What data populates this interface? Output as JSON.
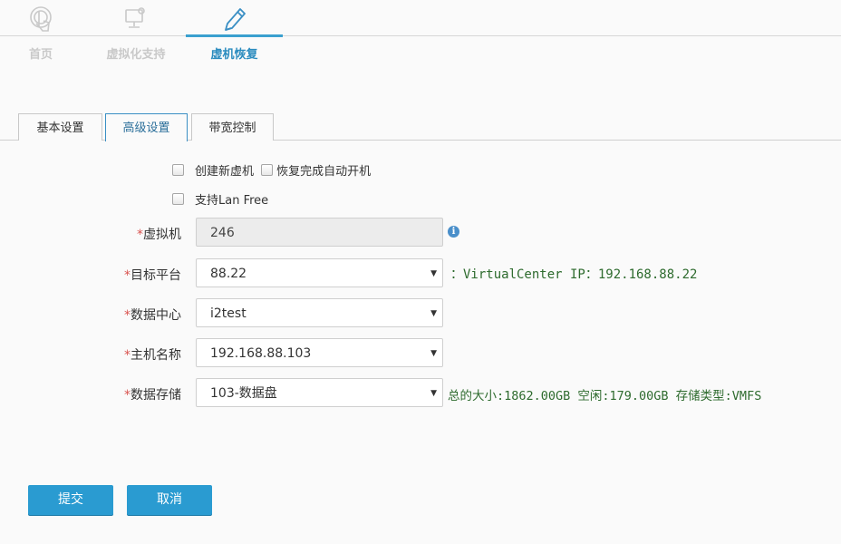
{
  "nav": {
    "items": [
      {
        "label": "首页",
        "icon": "touch-icon"
      },
      {
        "label": "虚拟化支持",
        "icon": "monitor-settings-icon"
      },
      {
        "label": "虚机恢复",
        "icon": "pencil-icon"
      }
    ],
    "active_index": 2
  },
  "tabs": [
    {
      "label": "基本设置"
    },
    {
      "label": "高级设置"
    },
    {
      "label": "带宽控制"
    }
  ],
  "active_tab": 1,
  "options": {
    "create_vm": "创建新虚机",
    "auto_start": "恢复完成自动开机",
    "lan_free": "支持Lan Free"
  },
  "form": {
    "required_mark": "*",
    "vm": {
      "label": "虚拟机",
      "value": "246"
    },
    "platform": {
      "label": "目标平台",
      "value": "88.22",
      "note": "：VirtualCenter IP：192.168.88.22"
    },
    "datacenter": {
      "label": "数据中心",
      "value": "i2test"
    },
    "host": {
      "label": "主机名称",
      "value": "192.168.88.103"
    },
    "datastore": {
      "label": "数据存储",
      "value": "103-数据盘",
      "note": "总的大小:1862.00GB 空闲:179.00GB 存储类型:VMFS"
    }
  },
  "buttons": {
    "submit": "提交",
    "cancel": "取消"
  },
  "colors": {
    "accent": "#2a9bd1",
    "required": "#d9534f",
    "note": "#2e6b2e"
  }
}
